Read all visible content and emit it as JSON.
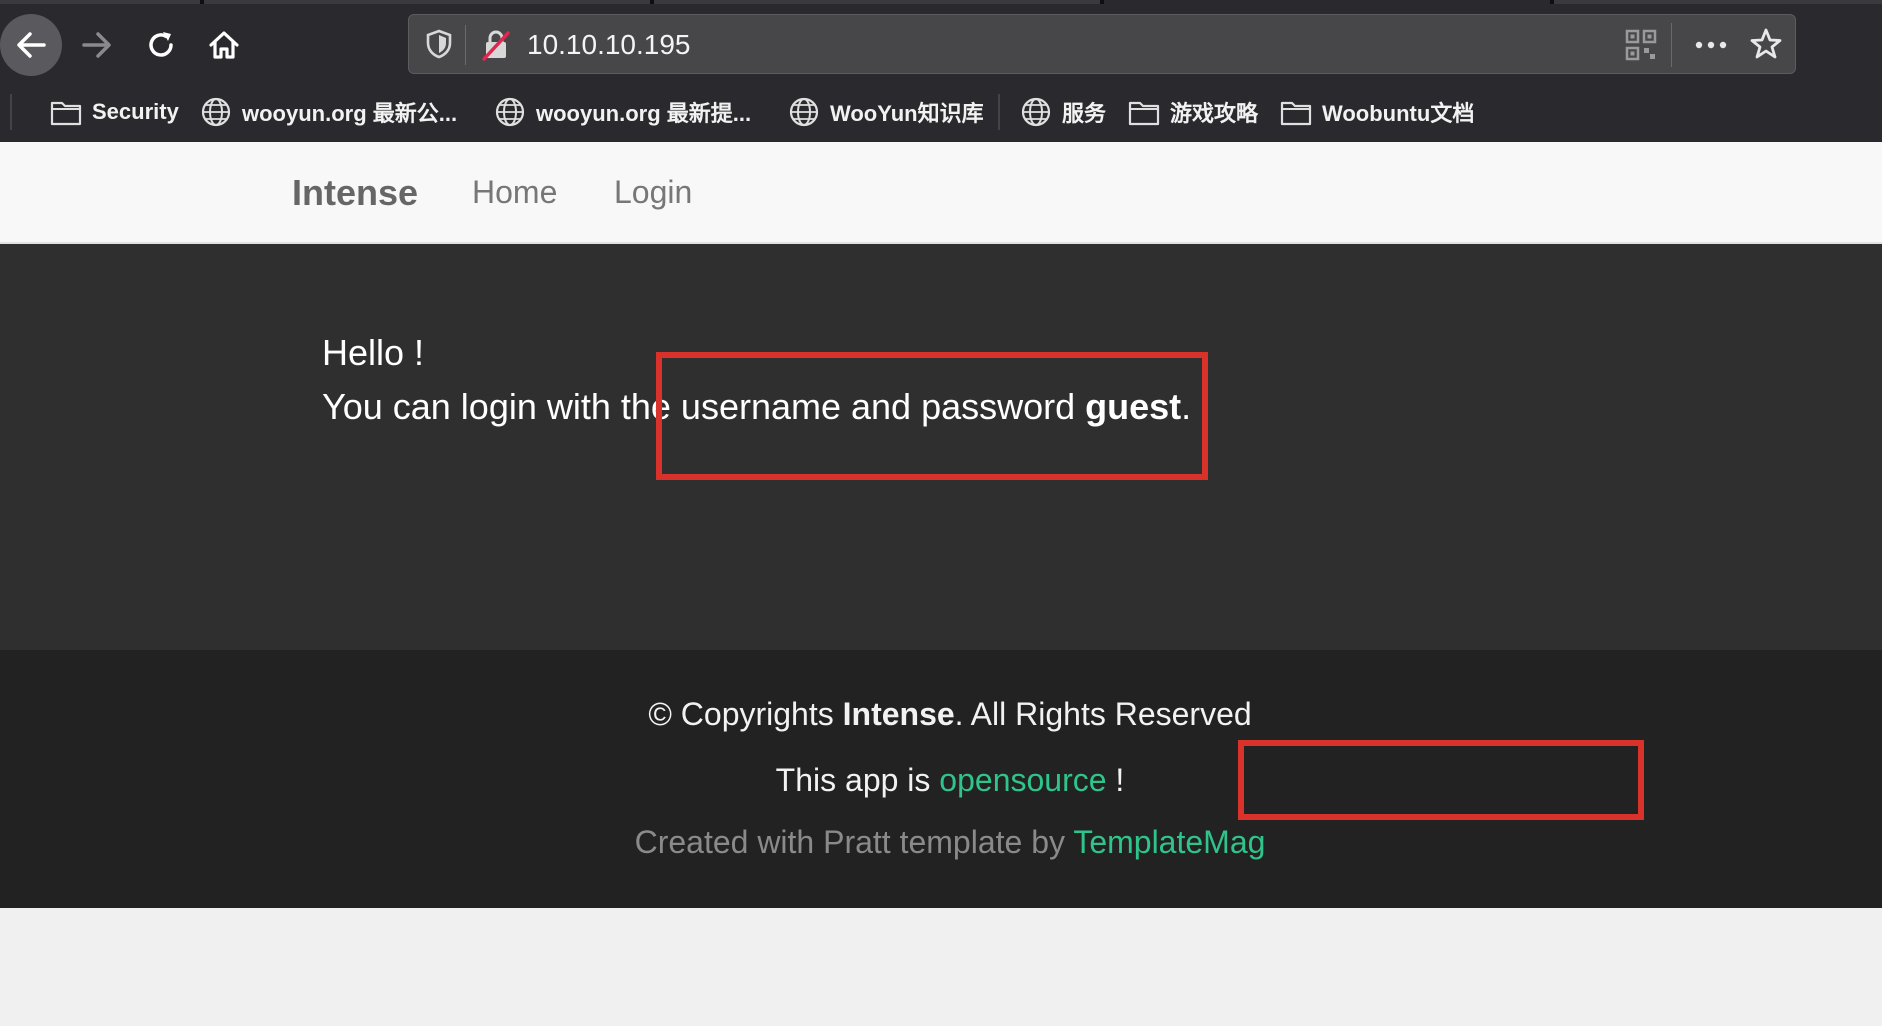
{
  "browser": {
    "url": "10.10.10.195",
    "bookmarks": [
      {
        "label": "Security",
        "icon": "folder-icon"
      },
      {
        "label": "wooyun.org 最新公...",
        "icon": "globe-icon"
      },
      {
        "label": "wooyun.org 最新提...",
        "icon": "globe-icon"
      },
      {
        "label": "WooYun知识库",
        "icon": "globe-icon"
      },
      {
        "label": "服务",
        "icon": "globe-icon"
      },
      {
        "label": "游戏攻略",
        "icon": "folder-icon"
      },
      {
        "label": "Woobuntu文档",
        "icon": "folder-icon"
      }
    ]
  },
  "navbar": {
    "brand": "Intense",
    "home": "Home",
    "login": "Login"
  },
  "hero": {
    "greeting": "Hello !",
    "login_prefix": "You can login with the username and password ",
    "login_credential": "guest",
    "login_suffix": "."
  },
  "footer": {
    "copyright_prefix": "© Copyrights ",
    "copyright_brand": "Intense",
    "copyright_suffix": ". All Rights Reserved",
    "opensource_prefix": "This app is ",
    "opensource_link": "opensource",
    "opensource_suffix": " !",
    "created_prefix": "Created with Pratt template by ",
    "created_link": "TemplateMag"
  },
  "colors": {
    "annotation_box": "#d8322a",
    "link_green": "#2ec48a",
    "hero_bg": "#2f2f2f",
    "footer_bg": "#222222"
  }
}
